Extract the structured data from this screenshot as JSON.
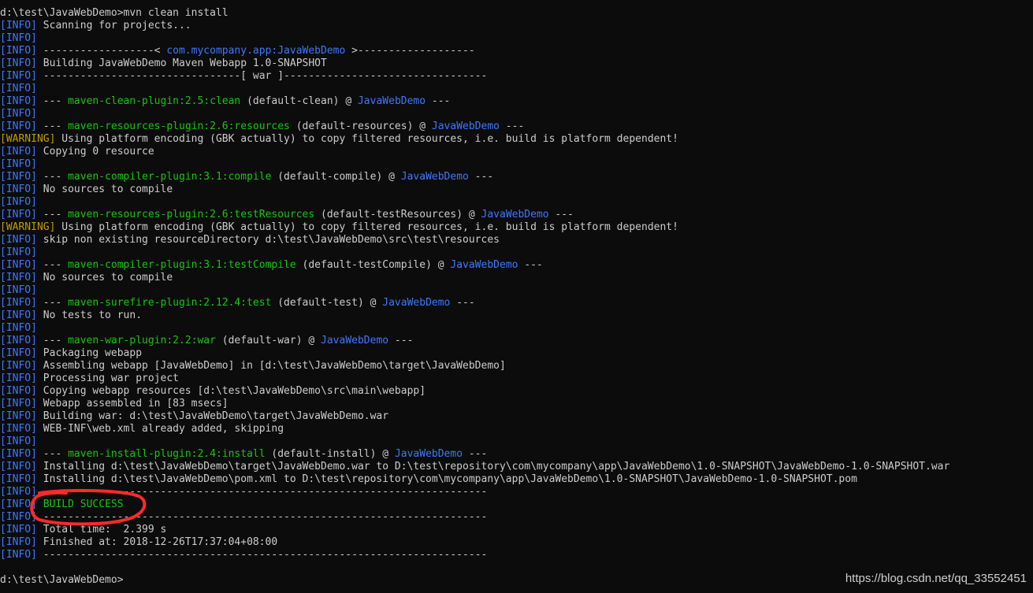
{
  "colors": {
    "background": "#0c0c0c",
    "text": "#cccccc",
    "info_tag": "#3b78ff",
    "warning_tag": "#c19c00",
    "plugin_green": "#16c60c",
    "project_blue": "#3b78ff",
    "annotation_red": "#ff2a2a"
  },
  "terminal": {
    "lines": [
      {
        "segments": [
          {
            "t": "d:\\test\\JavaWebDemo>mvn clean install",
            "c": "text"
          }
        ]
      },
      {
        "segments": [
          {
            "t": "[INFO]",
            "c": "info"
          },
          {
            "t": " Scanning for projects...",
            "c": "text"
          }
        ]
      },
      {
        "segments": [
          {
            "t": "[INFO]",
            "c": "info"
          }
        ]
      },
      {
        "segments": [
          {
            "t": "[INFO]",
            "c": "info"
          },
          {
            "t": " ------------------< ",
            "c": "text"
          },
          {
            "t": "com.mycompany.app:JavaWebDemo",
            "c": "blue"
          },
          {
            "t": " >-------------------",
            "c": "text"
          }
        ]
      },
      {
        "segments": [
          {
            "t": "[INFO]",
            "c": "info"
          },
          {
            "t": " Building JavaWebDemo Maven Webapp 1.0-SNAPSHOT",
            "c": "text"
          }
        ]
      },
      {
        "segments": [
          {
            "t": "[INFO]",
            "c": "info"
          },
          {
            "t": " --------------------------------[ war ]---------------------------------",
            "c": "text"
          }
        ]
      },
      {
        "segments": [
          {
            "t": "[INFO]",
            "c": "info"
          }
        ]
      },
      {
        "segments": [
          {
            "t": "[INFO]",
            "c": "info"
          },
          {
            "t": " --- ",
            "c": "text"
          },
          {
            "t": "maven-clean-plugin:2.5:clean",
            "c": "green"
          },
          {
            "t": " (default-clean) @ ",
            "c": "text"
          },
          {
            "t": "JavaWebDemo",
            "c": "blue"
          },
          {
            "t": " ---",
            "c": "text"
          }
        ]
      },
      {
        "segments": [
          {
            "t": "[INFO]",
            "c": "info"
          }
        ]
      },
      {
        "segments": [
          {
            "t": "[INFO]",
            "c": "info"
          },
          {
            "t": " --- ",
            "c": "text"
          },
          {
            "t": "maven-resources-plugin:2.6:resources",
            "c": "green"
          },
          {
            "t": " (default-resources) @ ",
            "c": "text"
          },
          {
            "t": "JavaWebDemo",
            "c": "blue"
          },
          {
            "t": " ---",
            "c": "text"
          }
        ]
      },
      {
        "segments": [
          {
            "t": "[WARNING]",
            "c": "warn"
          },
          {
            "t": " Using platform encoding (GBK actually) to copy filtered resources, i.e. build is platform dependent!",
            "c": "text"
          }
        ]
      },
      {
        "segments": [
          {
            "t": "[INFO]",
            "c": "info"
          },
          {
            "t": " Copying 0 resource",
            "c": "text"
          }
        ]
      },
      {
        "segments": [
          {
            "t": "[INFO]",
            "c": "info"
          }
        ]
      },
      {
        "segments": [
          {
            "t": "[INFO]",
            "c": "info"
          },
          {
            "t": " --- ",
            "c": "text"
          },
          {
            "t": "maven-compiler-plugin:3.1:compile",
            "c": "green"
          },
          {
            "t": " (default-compile) @ ",
            "c": "text"
          },
          {
            "t": "JavaWebDemo",
            "c": "blue"
          },
          {
            "t": " ---",
            "c": "text"
          }
        ]
      },
      {
        "segments": [
          {
            "t": "[INFO]",
            "c": "info"
          },
          {
            "t": " No sources to compile",
            "c": "text"
          }
        ]
      },
      {
        "segments": [
          {
            "t": "[INFO]",
            "c": "info"
          }
        ]
      },
      {
        "segments": [
          {
            "t": "[INFO]",
            "c": "info"
          },
          {
            "t": " --- ",
            "c": "text"
          },
          {
            "t": "maven-resources-plugin:2.6:testResources",
            "c": "green"
          },
          {
            "t": " (default-testResources) @ ",
            "c": "text"
          },
          {
            "t": "JavaWebDemo",
            "c": "blue"
          },
          {
            "t": " ---",
            "c": "text"
          }
        ]
      },
      {
        "segments": [
          {
            "t": "[WARNING]",
            "c": "warn"
          },
          {
            "t": " Using platform encoding (GBK actually) to copy filtered resources, i.e. build is platform dependent!",
            "c": "text"
          }
        ]
      },
      {
        "segments": [
          {
            "t": "[INFO]",
            "c": "info"
          },
          {
            "t": " skip non existing resourceDirectory d:\\test\\JavaWebDemo\\src\\test\\resources",
            "c": "text"
          }
        ]
      },
      {
        "segments": [
          {
            "t": "[INFO]",
            "c": "info"
          }
        ]
      },
      {
        "segments": [
          {
            "t": "[INFO]",
            "c": "info"
          },
          {
            "t": " --- ",
            "c": "text"
          },
          {
            "t": "maven-compiler-plugin:3.1:testCompile",
            "c": "green"
          },
          {
            "t": " (default-testCompile) @ ",
            "c": "text"
          },
          {
            "t": "JavaWebDemo",
            "c": "blue"
          },
          {
            "t": " ---",
            "c": "text"
          }
        ]
      },
      {
        "segments": [
          {
            "t": "[INFO]",
            "c": "info"
          },
          {
            "t": " No sources to compile",
            "c": "text"
          }
        ]
      },
      {
        "segments": [
          {
            "t": "[INFO]",
            "c": "info"
          }
        ]
      },
      {
        "segments": [
          {
            "t": "[INFO]",
            "c": "info"
          },
          {
            "t": " --- ",
            "c": "text"
          },
          {
            "t": "maven-surefire-plugin:2.12.4:test",
            "c": "green"
          },
          {
            "t": " (default-test) @ ",
            "c": "text"
          },
          {
            "t": "JavaWebDemo",
            "c": "blue"
          },
          {
            "t": " ---",
            "c": "text"
          }
        ]
      },
      {
        "segments": [
          {
            "t": "[INFO]",
            "c": "info"
          },
          {
            "t": " No tests to run.",
            "c": "text"
          }
        ]
      },
      {
        "segments": [
          {
            "t": "[INFO]",
            "c": "info"
          }
        ]
      },
      {
        "segments": [
          {
            "t": "[INFO]",
            "c": "info"
          },
          {
            "t": " --- ",
            "c": "text"
          },
          {
            "t": "maven-war-plugin:2.2:war",
            "c": "green"
          },
          {
            "t": " (default-war) @ ",
            "c": "text"
          },
          {
            "t": "JavaWebDemo",
            "c": "blue"
          },
          {
            "t": " ---",
            "c": "text"
          }
        ]
      },
      {
        "segments": [
          {
            "t": "[INFO]",
            "c": "info"
          },
          {
            "t": " Packaging webapp",
            "c": "text"
          }
        ]
      },
      {
        "segments": [
          {
            "t": "[INFO]",
            "c": "info"
          },
          {
            "t": " Assembling webapp [JavaWebDemo] in [d:\\test\\JavaWebDemo\\target\\JavaWebDemo]",
            "c": "text"
          }
        ]
      },
      {
        "segments": [
          {
            "t": "[INFO]",
            "c": "info"
          },
          {
            "t": " Processing war project",
            "c": "text"
          }
        ]
      },
      {
        "segments": [
          {
            "t": "[INFO]",
            "c": "info"
          },
          {
            "t": " Copying webapp resources [d:\\test\\JavaWebDemo\\src\\main\\webapp]",
            "c": "text"
          }
        ]
      },
      {
        "segments": [
          {
            "t": "[INFO]",
            "c": "info"
          },
          {
            "t": " Webapp assembled in [83 msecs]",
            "c": "text"
          }
        ]
      },
      {
        "segments": [
          {
            "t": "[INFO]",
            "c": "info"
          },
          {
            "t": " Building war: d:\\test\\JavaWebDemo\\target\\JavaWebDemo.war",
            "c": "text"
          }
        ]
      },
      {
        "segments": [
          {
            "t": "[INFO]",
            "c": "info"
          },
          {
            "t": " WEB-INF\\web.xml already added, skipping",
            "c": "text"
          }
        ]
      },
      {
        "segments": [
          {
            "t": "[INFO]",
            "c": "info"
          }
        ]
      },
      {
        "segments": [
          {
            "t": "[INFO]",
            "c": "info"
          },
          {
            "t": " --- ",
            "c": "text"
          },
          {
            "t": "maven-install-plugin:2.4:install",
            "c": "green"
          },
          {
            "t": " (default-install) @ ",
            "c": "text"
          },
          {
            "t": "JavaWebDemo",
            "c": "blue"
          },
          {
            "t": " ---",
            "c": "text"
          }
        ]
      },
      {
        "segments": [
          {
            "t": "[INFO]",
            "c": "info"
          },
          {
            "t": " Installing d:\\test\\JavaWebDemo\\target\\JavaWebDemo.war to D:\\test\\repository\\com\\mycompany\\app\\JavaWebDemo\\1.0-SNAPSHOT\\JavaWebDemo-1.0-SNAPSHOT.war",
            "c": "text"
          }
        ]
      },
      {
        "segments": [
          {
            "t": "[INFO]",
            "c": "info"
          },
          {
            "t": " Installing d:\\test\\JavaWebDemo\\pom.xml to D:\\test\\repository\\com\\mycompany\\app\\JavaWebDemo\\1.0-SNAPSHOT\\JavaWebDemo-1.0-SNAPSHOT.pom",
            "c": "text"
          }
        ]
      },
      {
        "segments": [
          {
            "t": "[INFO]",
            "c": "info"
          },
          {
            "t": " ------------------------------------------------------------------------",
            "c": "text"
          }
        ]
      },
      {
        "segments": [
          {
            "t": "[INFO]",
            "c": "info"
          },
          {
            "t": " ",
            "c": "text"
          },
          {
            "t": "BUILD SUCCESS",
            "c": "green"
          }
        ]
      },
      {
        "segments": [
          {
            "t": "[INFO]",
            "c": "info"
          },
          {
            "t": " ------------------------------------------------------------------------",
            "c": "text"
          }
        ]
      },
      {
        "segments": [
          {
            "t": "[INFO]",
            "c": "info"
          },
          {
            "t": " Total time:  2.399 s",
            "c": "text"
          }
        ]
      },
      {
        "segments": [
          {
            "t": "[INFO]",
            "c": "info"
          },
          {
            "t": " Finished at: 2018-12-26T17:37:04+08:00",
            "c": "text"
          }
        ]
      },
      {
        "segments": [
          {
            "t": "[INFO]",
            "c": "info"
          },
          {
            "t": " ------------------------------------------------------------------------",
            "c": "text"
          }
        ]
      },
      {
        "segments": [
          {
            "t": " ",
            "c": "text"
          }
        ]
      },
      {
        "segments": [
          {
            "t": "d:\\test\\JavaWebDemo>",
            "c": "text"
          }
        ]
      }
    ]
  },
  "watermark": {
    "text": "https://blog.csdn.net/qq_33552451"
  }
}
